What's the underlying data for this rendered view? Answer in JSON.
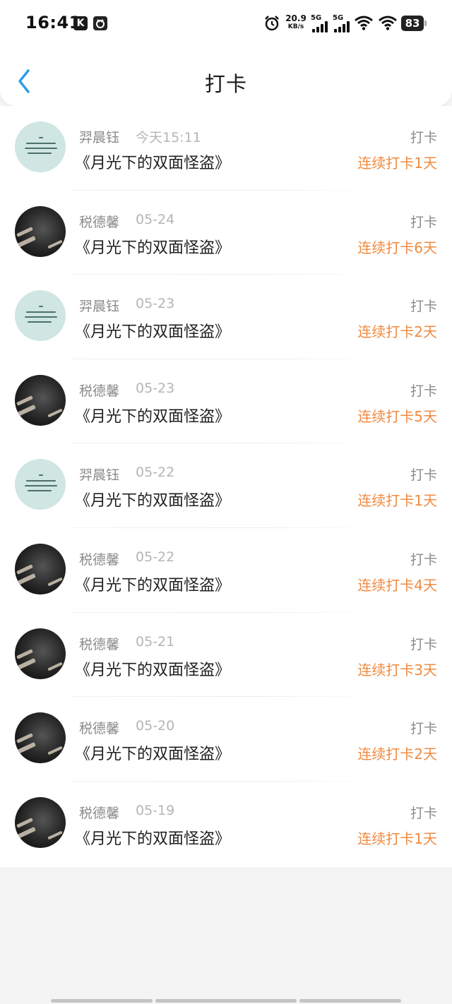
{
  "status_bar": {
    "time": "16:41",
    "app_icons": [
      "K",
      "app-icon"
    ],
    "net_speed": "20.9",
    "net_unit": "KB/s",
    "sim1": "5G",
    "sim2": "5G",
    "battery": "83"
  },
  "header": {
    "title": "打卡",
    "back_icon": "chevron-left-icon",
    "accent_color": "#2f9de8"
  },
  "colors": {
    "streak": "#f08a3f",
    "muted": "#8a8a8a",
    "date": "#b5b5b5"
  },
  "entries": [
    {
      "user": "羿晨钰",
      "date": "今天15:11",
      "book": "《月光下的双面怪盗》",
      "tag": "打卡",
      "streak": "连续打卡1天",
      "avatar": "green"
    },
    {
      "user": "税德馨",
      "date": "05-24",
      "book": "《月光下的双面怪盗》",
      "tag": "打卡",
      "streak": "连续打卡6天",
      "avatar": "dark"
    },
    {
      "user": "羿晨钰",
      "date": "05-23",
      "book": "《月光下的双面怪盗》",
      "tag": "打卡",
      "streak": "连续打卡2天",
      "avatar": "green"
    },
    {
      "user": "税德馨",
      "date": "05-23",
      "book": "《月光下的双面怪盗》",
      "tag": "打卡",
      "streak": "连续打卡5天",
      "avatar": "dark"
    },
    {
      "user": "羿晨钰",
      "date": "05-22",
      "book": "《月光下的双面怪盗》",
      "tag": "打卡",
      "streak": "连续打卡1天",
      "avatar": "green"
    },
    {
      "user": "税德馨",
      "date": "05-22",
      "book": "《月光下的双面怪盗》",
      "tag": "打卡",
      "streak": "连续打卡4天",
      "avatar": "dark"
    },
    {
      "user": "税德馨",
      "date": "05-21",
      "book": "《月光下的双面怪盗》",
      "tag": "打卡",
      "streak": "连续打卡3天",
      "avatar": "dark"
    },
    {
      "user": "税德馨",
      "date": "05-20",
      "book": "《月光下的双面怪盗》",
      "tag": "打卡",
      "streak": "连续打卡2天",
      "avatar": "dark"
    },
    {
      "user": "税德馨",
      "date": "05-19",
      "book": "《月光下的双面怪盗》",
      "tag": "打卡",
      "streak": "连续打卡1天",
      "avatar": "dark"
    }
  ]
}
